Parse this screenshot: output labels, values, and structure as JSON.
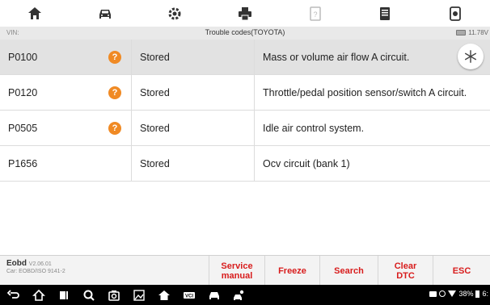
{
  "toolbar": {
    "icons": [
      "home-icon",
      "car-icon",
      "settings-icon",
      "print-icon",
      "help-icon",
      "save-icon",
      "screenshot-icon"
    ]
  },
  "infobar": {
    "vin_label": "VIN:",
    "title": "Trouble codes(TOYOTA)",
    "battery_voltage": "11.78V"
  },
  "dtc": {
    "rows": [
      {
        "code": "P0100",
        "status": "Stored",
        "description": "Mass or volume air flow A circuit.",
        "help": true,
        "selected": true
      },
      {
        "code": "P0120",
        "status": "Stored",
        "description": "Throttle/pedal position sensor/switch A circuit.",
        "help": true,
        "selected": false
      },
      {
        "code": "P0505",
        "status": "Stored",
        "description": "Idle air control system.",
        "help": true,
        "selected": false
      },
      {
        "code": "P1656",
        "status": "Stored",
        "description": "Ocv circuit (bank 1)",
        "help": false,
        "selected": false
      }
    ],
    "help_glyph": "?"
  },
  "actionbar": {
    "app_name": "Eobd",
    "app_version": "V2.06.01",
    "car_info": "Car: EOBD/ISO 9141-2",
    "buttons": {
      "service_manual": "Service manual",
      "freeze": "Freeze",
      "search": "Search",
      "clear_dtc": "Clear DTC",
      "esc": "ESC"
    }
  },
  "statusbar": {
    "battery_percent": "38%",
    "time_fragment": "6:"
  },
  "colors": {
    "accent_red": "#d81c1c",
    "help_orange": "#f08a24",
    "selected_row": "#e2e2e2"
  }
}
